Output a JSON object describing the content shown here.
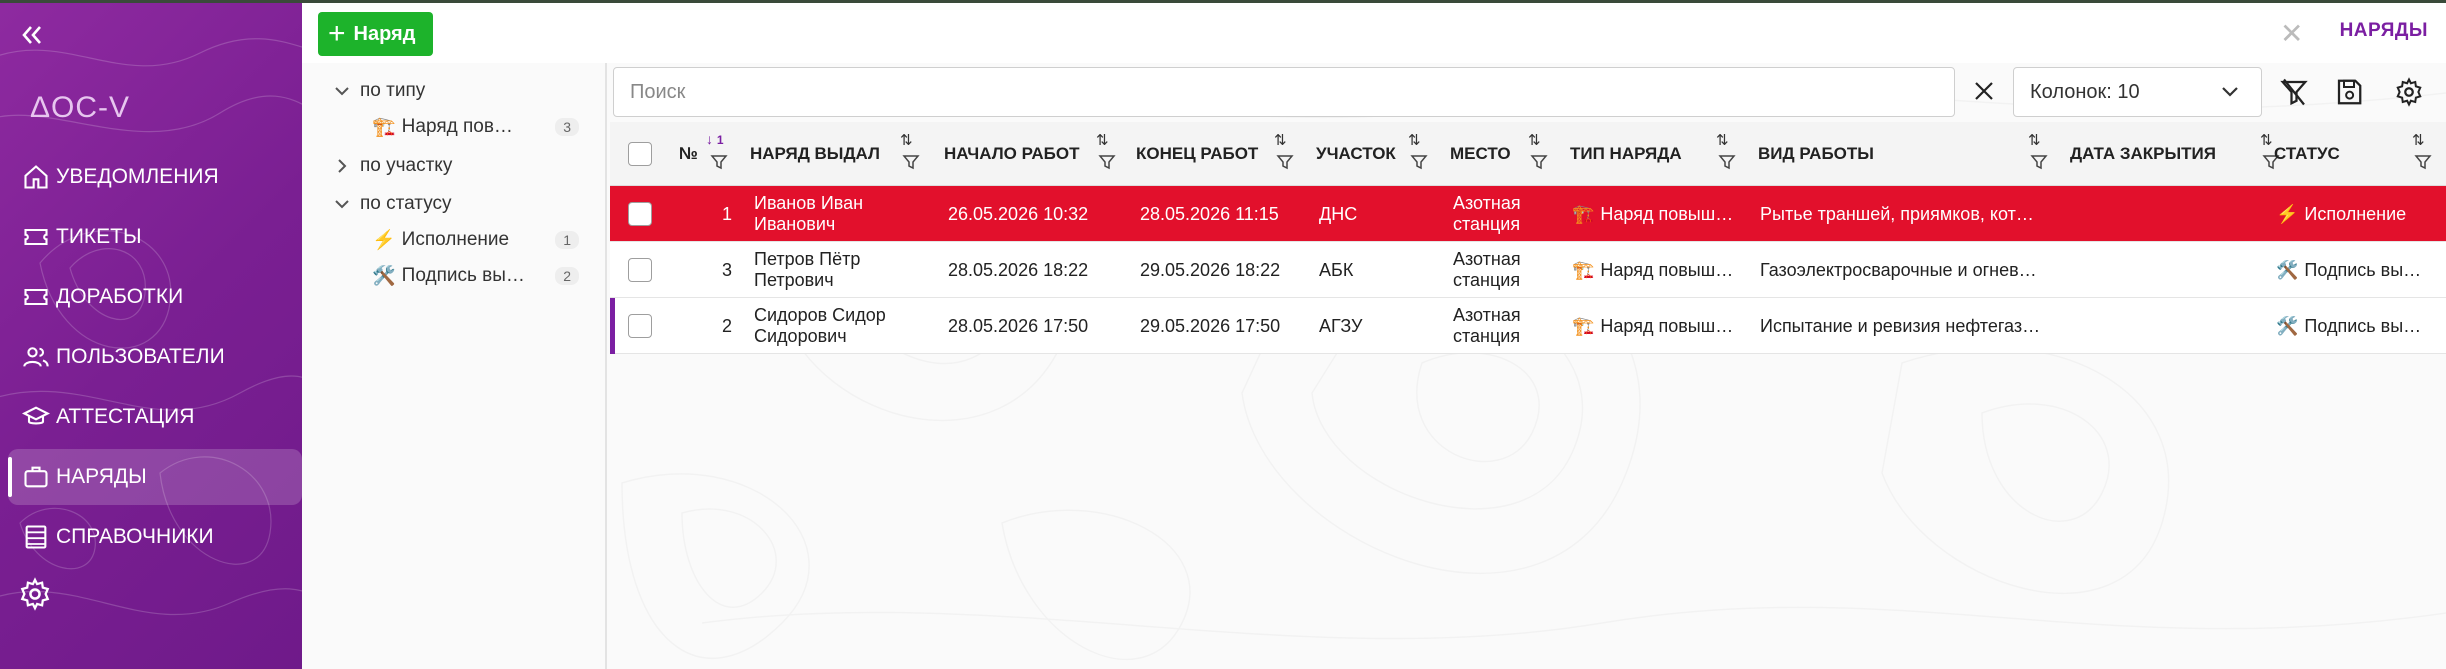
{
  "app": {
    "logo": "ΔOC-V",
    "collapse_icon": "double-chevron-left-icon"
  },
  "sidebar": {
    "items": [
      {
        "label": "УВЕДОМЛЕНИЯ",
        "icon": "home-icon",
        "active": false
      },
      {
        "label": "ТИКЕТЫ",
        "icon": "ticket-icon",
        "active": false
      },
      {
        "label": "ДОРАБОТКИ",
        "icon": "ticket-icon",
        "active": false
      },
      {
        "label": "ПОЛЬЗОВАТЕЛИ",
        "icon": "users-icon",
        "active": false
      },
      {
        "label": "АТТЕСТАЦИЯ",
        "icon": "graduation-cap-icon",
        "active": false
      },
      {
        "label": "НАРЯДЫ",
        "icon": "briefcase-icon",
        "active": true
      },
      {
        "label": "СПРАВОЧНИКИ",
        "icon": "list-icon",
        "active": false
      }
    ],
    "settings_icon": "gear-icon"
  },
  "header": {
    "add_label": "Наряд",
    "title": "НАРЯДЫ"
  },
  "tree": {
    "groups": [
      {
        "label": "по типу",
        "expanded": true,
        "items": [
          {
            "emoji": "🏗️",
            "label": "Наряд пов…",
            "count": "3"
          }
        ]
      },
      {
        "label": "по участку",
        "expanded": false,
        "items": []
      },
      {
        "label": "по статусу",
        "expanded": true,
        "items": [
          {
            "emoji": "⚡",
            "label": "Исполнение",
            "count": "1"
          },
          {
            "emoji": "🛠️",
            "label": "Подпись вы…",
            "count": "2"
          }
        ]
      }
    ]
  },
  "toolbar": {
    "search_placeholder": "Поиск",
    "columns_label": "Колонок: 10"
  },
  "table": {
    "columns": [
      "№",
      "НАРЯД ВЫДАЛ",
      "НАЧАЛО РАБОТ",
      "КОНЕЦ РАБОТ",
      "УЧАСТОК",
      "МЕСТО",
      "ТИП НАРЯДА",
      "ВИД РАБОТЫ",
      "ДАТА ЗАКРЫТИЯ",
      "СТАТУС"
    ],
    "sort_badge": "1",
    "rows": [
      {
        "num": "1",
        "issuer": "Иванов Иван Иванович",
        "start": "26.05.2026 10:32",
        "end": "28.05.2026 11:15",
        "area": "ДНС",
        "place": "Азотная станция",
        "type_emoji": "🏗️",
        "type": "Наряд повыш…",
        "work": "Рытье траншей, приямков, кот…",
        "closed": "",
        "status_emoji": "⚡",
        "status": "Исполнение",
        "selected": true
      },
      {
        "num": "3",
        "issuer": "Петров Пётр Петрович",
        "start": "28.05.2026 18:22",
        "end": "29.05.2026 18:22",
        "area": "АБК",
        "place": "Азотная станция",
        "type_emoji": "🏗️",
        "type": "Наряд повыш…",
        "work": "Газоэлектросварочные и огнев…",
        "closed": "",
        "status_emoji": "🛠️",
        "status": "Подпись вы…",
        "selected": false
      },
      {
        "num": "2",
        "issuer": "Сидоров Сидор Сидорович",
        "start": "28.05.2026 17:50",
        "end": "29.05.2026 17:50",
        "area": "АГЗУ",
        "place": "Азотная станция",
        "type_emoji": "🏗️",
        "type": "Наряд повыш…",
        "work": "Испытание и ревизия нефтегаз…",
        "closed": "",
        "status_emoji": "🛠️",
        "status": "Подпись вы…",
        "selected": false
      }
    ]
  },
  "colors": {
    "sidebar": "#7a1f92",
    "accent": "#7b1fa2",
    "add_button": "#1db32b",
    "selected_row": "#e2102c"
  }
}
